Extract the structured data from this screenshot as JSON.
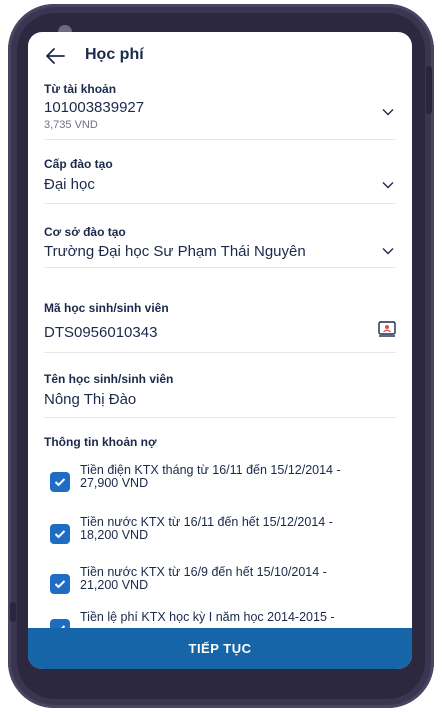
{
  "header": {
    "title": "Học phí"
  },
  "from_account": {
    "label": "Từ tài khoản",
    "account_number": "101003839927",
    "balance": "3,735 VND"
  },
  "training_level": {
    "label": "Cấp đào tạo",
    "value": "Đại học"
  },
  "institution": {
    "label": "Cơ sở đào tạo",
    "value": "Trường Đại học Sư Phạm Thái Nguyên"
  },
  "student_id": {
    "label": "Mã học sinh/sinh viên",
    "value": "DTS0956010343"
  },
  "student_name": {
    "label": "Tên học sinh/sinh viên",
    "value": "Nông Thị Đào"
  },
  "debt_info": {
    "title": "Thông tin khoản nợ",
    "items": [
      {
        "line1": "Tiền điện KTX tháng từ 16/11 đến 15/12/2014 -",
        "line2": "27,900 VND",
        "checked": true
      },
      {
        "line1": "Tiền nước KTX từ 16/11 đến hết 15/12/2014 -",
        "line2": "18,200 VND",
        "checked": true
      },
      {
        "line1": "Tiền nước KTX từ 16/9 đến hết 15/10/2014 -",
        "line2": "21,200 VND",
        "checked": true
      },
      {
        "line1": "Tiền lệ phí KTX học kỳ I năm học 2014-2015 -",
        "line2": "",
        "checked": true
      }
    ]
  },
  "actions": {
    "continue_label": "TIẾP TỤC"
  },
  "colors": {
    "primary": "#1565a8",
    "checkbox": "#1f6cc5",
    "text": "#1b2a4a",
    "frame": "#3a3550"
  }
}
